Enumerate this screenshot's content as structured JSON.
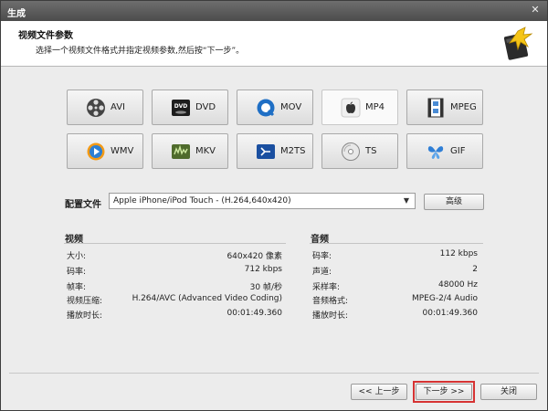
{
  "window": {
    "title": "生成"
  },
  "header": {
    "title": "视频文件参数",
    "subtitle": "选择一个视频文件格式并指定视频参数,然后按“下一步”。"
  },
  "formats": [
    {
      "label": "AVI",
      "icon": "film-reel-icon",
      "selected": false
    },
    {
      "label": "DVD",
      "icon": "dvd-icon",
      "selected": false
    },
    {
      "label": "MOV",
      "icon": "quicktime-icon",
      "selected": false
    },
    {
      "label": "MP4",
      "icon": "apple-icon",
      "selected": true
    },
    {
      "label": "MPEG",
      "icon": "film-strip-icon",
      "selected": false
    },
    {
      "label": "WMV",
      "icon": "windows-media-icon",
      "selected": false
    },
    {
      "label": "MKV",
      "icon": "mkv-icon",
      "selected": false
    },
    {
      "label": "M2TS",
      "icon": "bluray-icon",
      "selected": false
    },
    {
      "label": "TS",
      "icon": "disc-icon",
      "selected": false
    },
    {
      "label": "GIF",
      "icon": "butterfly-icon",
      "selected": false
    }
  ],
  "profile": {
    "label": "配置文件",
    "value": "Apple iPhone/iPod Touch - (H.264,640x420)",
    "advanced_label": "高级"
  },
  "video": {
    "title": "视频",
    "rows": [
      {
        "label": "大小:",
        "value": "640x420 像素"
      },
      {
        "label": "码率:",
        "value": "712 kbps"
      },
      {
        "label": "帧率:",
        "value": "30 帧/秒"
      },
      {
        "label": "视频压缩:",
        "value": "H.264/AVC (Advanced Video Coding)"
      },
      {
        "label": "播放时长:",
        "value": "00:01:49.360"
      }
    ]
  },
  "audio": {
    "title": "音频",
    "rows": [
      {
        "label": "码率:",
        "value": "112 kbps"
      },
      {
        "label": "声道:",
        "value": "2"
      },
      {
        "label": "采样率:",
        "value": "48000 Hz"
      },
      {
        "label": "音频格式:",
        "value": "MPEG-2/4 Audio"
      },
      {
        "label": "播放时长:",
        "value": "00:01:49.360"
      }
    ]
  },
  "footer": {
    "prev_label": "<< 上一步",
    "next_label": "下一步 >>",
    "close_label": "关闭"
  },
  "colors": {
    "highlight_outline": "#d63333",
    "titlebar": "#5a5a5a"
  }
}
